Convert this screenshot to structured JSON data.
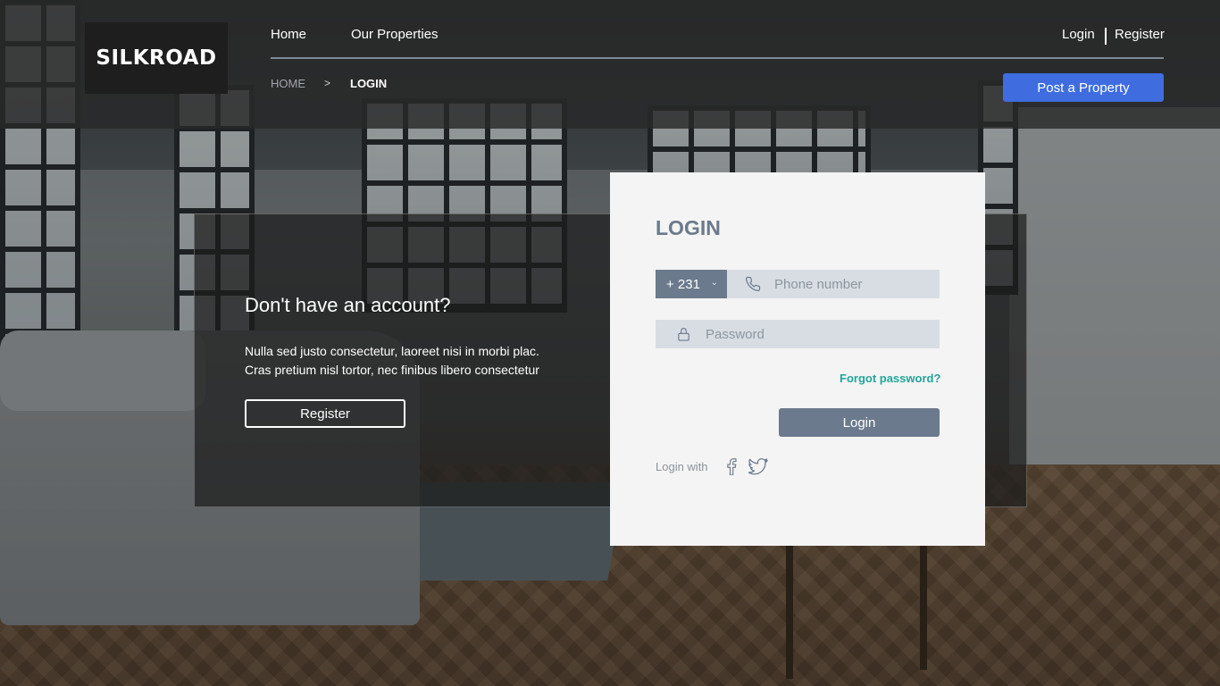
{
  "brand": {
    "logo": "SILKROAD"
  },
  "nav": {
    "home": "Home",
    "properties": "Our Properties",
    "login": "Login",
    "register": "Register"
  },
  "breadcrumb": {
    "home": "HOME",
    "separator": ">",
    "current": "LOGIN"
  },
  "header": {
    "post_property_label": "Post a Property"
  },
  "cta": {
    "title": "Don't have an account?",
    "text_line1": "Nulla sed justo consectetur, laoreet nisi in morbi plac.",
    "text_line2": "Cras pretium nisl tortor, nec finibus libero consectetur",
    "register_label": "Register"
  },
  "login_form": {
    "title": "LOGIN",
    "country_code": "+ 231",
    "phone_placeholder": "Phone number",
    "password_placeholder": "Password",
    "forgot_label": "Forgot password?",
    "submit_label": "Login",
    "login_with_label": "Login with"
  },
  "icons": {
    "chevron": "chevron-down-icon",
    "phone": "phone-icon",
    "lock": "lock-icon",
    "facebook": "facebook-icon",
    "twitter": "twitter-icon"
  },
  "colors": {
    "accent_blue": "#3f6de0",
    "slate": "#6b7a8c",
    "teal_link": "#23a59a"
  }
}
